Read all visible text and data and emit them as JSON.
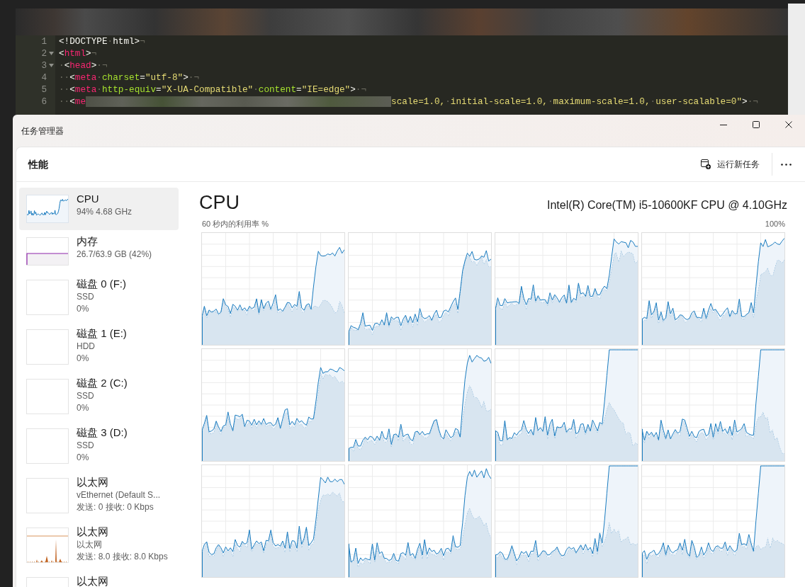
{
  "editor": {
    "lines": [
      {
        "number": "1",
        "foldable": false,
        "tokens": [
          {
            "kind": "text",
            "text": "<!DOCTYPE"
          },
          {
            "kind": "ws",
            "text": "·"
          },
          {
            "kind": "text",
            "text": "html>"
          },
          {
            "kind": "ws",
            "text": "¬"
          }
        ]
      },
      {
        "number": "2",
        "foldable": true,
        "tokens": [
          {
            "kind": "text",
            "text": "<"
          },
          {
            "kind": "tag",
            "text": "html"
          },
          {
            "kind": "text",
            "text": ">"
          },
          {
            "kind": "ws",
            "text": "¬"
          }
        ]
      },
      {
        "number": "3",
        "foldable": true,
        "tokens": [
          {
            "kind": "ws",
            "text": "·"
          },
          {
            "kind": "text",
            "text": "<"
          },
          {
            "kind": "tag",
            "text": "head"
          },
          {
            "kind": "text",
            "text": ">"
          },
          {
            "kind": "ws",
            "text": "·¬"
          }
        ]
      },
      {
        "number": "4",
        "foldable": false,
        "tokens": [
          {
            "kind": "ws",
            "text": "··"
          },
          {
            "kind": "text",
            "text": "<"
          },
          {
            "kind": "tag",
            "text": "meta"
          },
          {
            "kind": "ws",
            "text": "·"
          },
          {
            "kind": "attr",
            "text": "charset"
          },
          {
            "kind": "text",
            "text": "="
          },
          {
            "kind": "string",
            "text": "\"utf-8\""
          },
          {
            "kind": "text",
            "text": ">"
          },
          {
            "kind": "ws",
            "text": "·¬"
          }
        ]
      },
      {
        "number": "5",
        "foldable": false,
        "tokens": [
          {
            "kind": "ws",
            "text": "··"
          },
          {
            "kind": "text",
            "text": "<"
          },
          {
            "kind": "tag",
            "text": "meta"
          },
          {
            "kind": "ws",
            "text": "·"
          },
          {
            "kind": "attr",
            "text": "http-equiv"
          },
          {
            "kind": "text",
            "text": "="
          },
          {
            "kind": "string",
            "text": "\"X-UA-Compatible\""
          },
          {
            "kind": "ws",
            "text": "·"
          },
          {
            "kind": "attr",
            "text": "content"
          },
          {
            "kind": "text",
            "text": "="
          },
          {
            "kind": "string",
            "text": "\"IE=edge\""
          },
          {
            "kind": "text",
            "text": ">"
          },
          {
            "kind": "ws",
            "text": "·¬"
          }
        ]
      },
      {
        "number": "6",
        "foldable": false,
        "tokens": [
          {
            "kind": "ws",
            "text": "··"
          },
          {
            "kind": "text",
            "text": "<"
          },
          {
            "kind": "tag",
            "text": "me"
          },
          {
            "kind": "blur"
          },
          {
            "kind": "string",
            "text": "scale=1.0,"
          },
          {
            "kind": "ws",
            "text": "·"
          },
          {
            "kind": "string",
            "text": "initial-scale=1.0,"
          },
          {
            "kind": "ws",
            "text": "·"
          },
          {
            "kind": "string",
            "text": "maximum-scale=1.0,"
          },
          {
            "kind": "ws",
            "text": "·"
          },
          {
            "kind": "string",
            "text": "user-scalable=0\""
          },
          {
            "kind": "text",
            "text": ">"
          },
          {
            "kind": "ws",
            "text": "·¬"
          }
        ]
      }
    ]
  },
  "window": {
    "title": "任务管理器"
  },
  "header": {
    "title": "性能",
    "run_task_button": "运行新任务"
  },
  "sidebar": {
    "items": [
      {
        "kind": "cpu",
        "name": "CPU",
        "details": [
          "94% 4.68 GHz"
        ],
        "selected": true
      },
      {
        "kind": "memory",
        "name": "内存",
        "details": [
          "26.7/63.9 GB (42%)"
        ],
        "selected": false
      },
      {
        "kind": "disk",
        "name": "磁盘 0 (F:)",
        "details": [
          "SSD",
          "0%"
        ],
        "selected": false
      },
      {
        "kind": "disk",
        "name": "磁盘 1 (E:)",
        "details": [
          "HDD",
          "0%"
        ],
        "selected": false
      },
      {
        "kind": "disk",
        "name": "磁盘 2 (C:)",
        "details": [
          "SSD",
          "0%"
        ],
        "selected": false
      },
      {
        "kind": "disk",
        "name": "磁盘 3 (D:)",
        "details": [
          "SSD",
          "0%"
        ],
        "selected": false
      },
      {
        "kind": "network",
        "name": "以太网",
        "details": [
          "vEthernet (Default S...",
          "发送: 0 接收: 0 Kbps"
        ],
        "active": false,
        "selected": false
      },
      {
        "kind": "network",
        "name": "以太网",
        "details": [
          "以太网",
          "发送: 8.0 接收: 8.0 Kbps"
        ],
        "active": true,
        "selected": false
      },
      {
        "kind": "network",
        "name": "以太网",
        "active": false,
        "selected": false
      }
    ]
  },
  "main": {
    "title": "CPU",
    "processor": "Intel(R) Core(TM) i5-10600KF CPU @ 4.10GHz",
    "graph_caption": "60 秒内的利用率 %",
    "graph_scale": "100%"
  }
}
